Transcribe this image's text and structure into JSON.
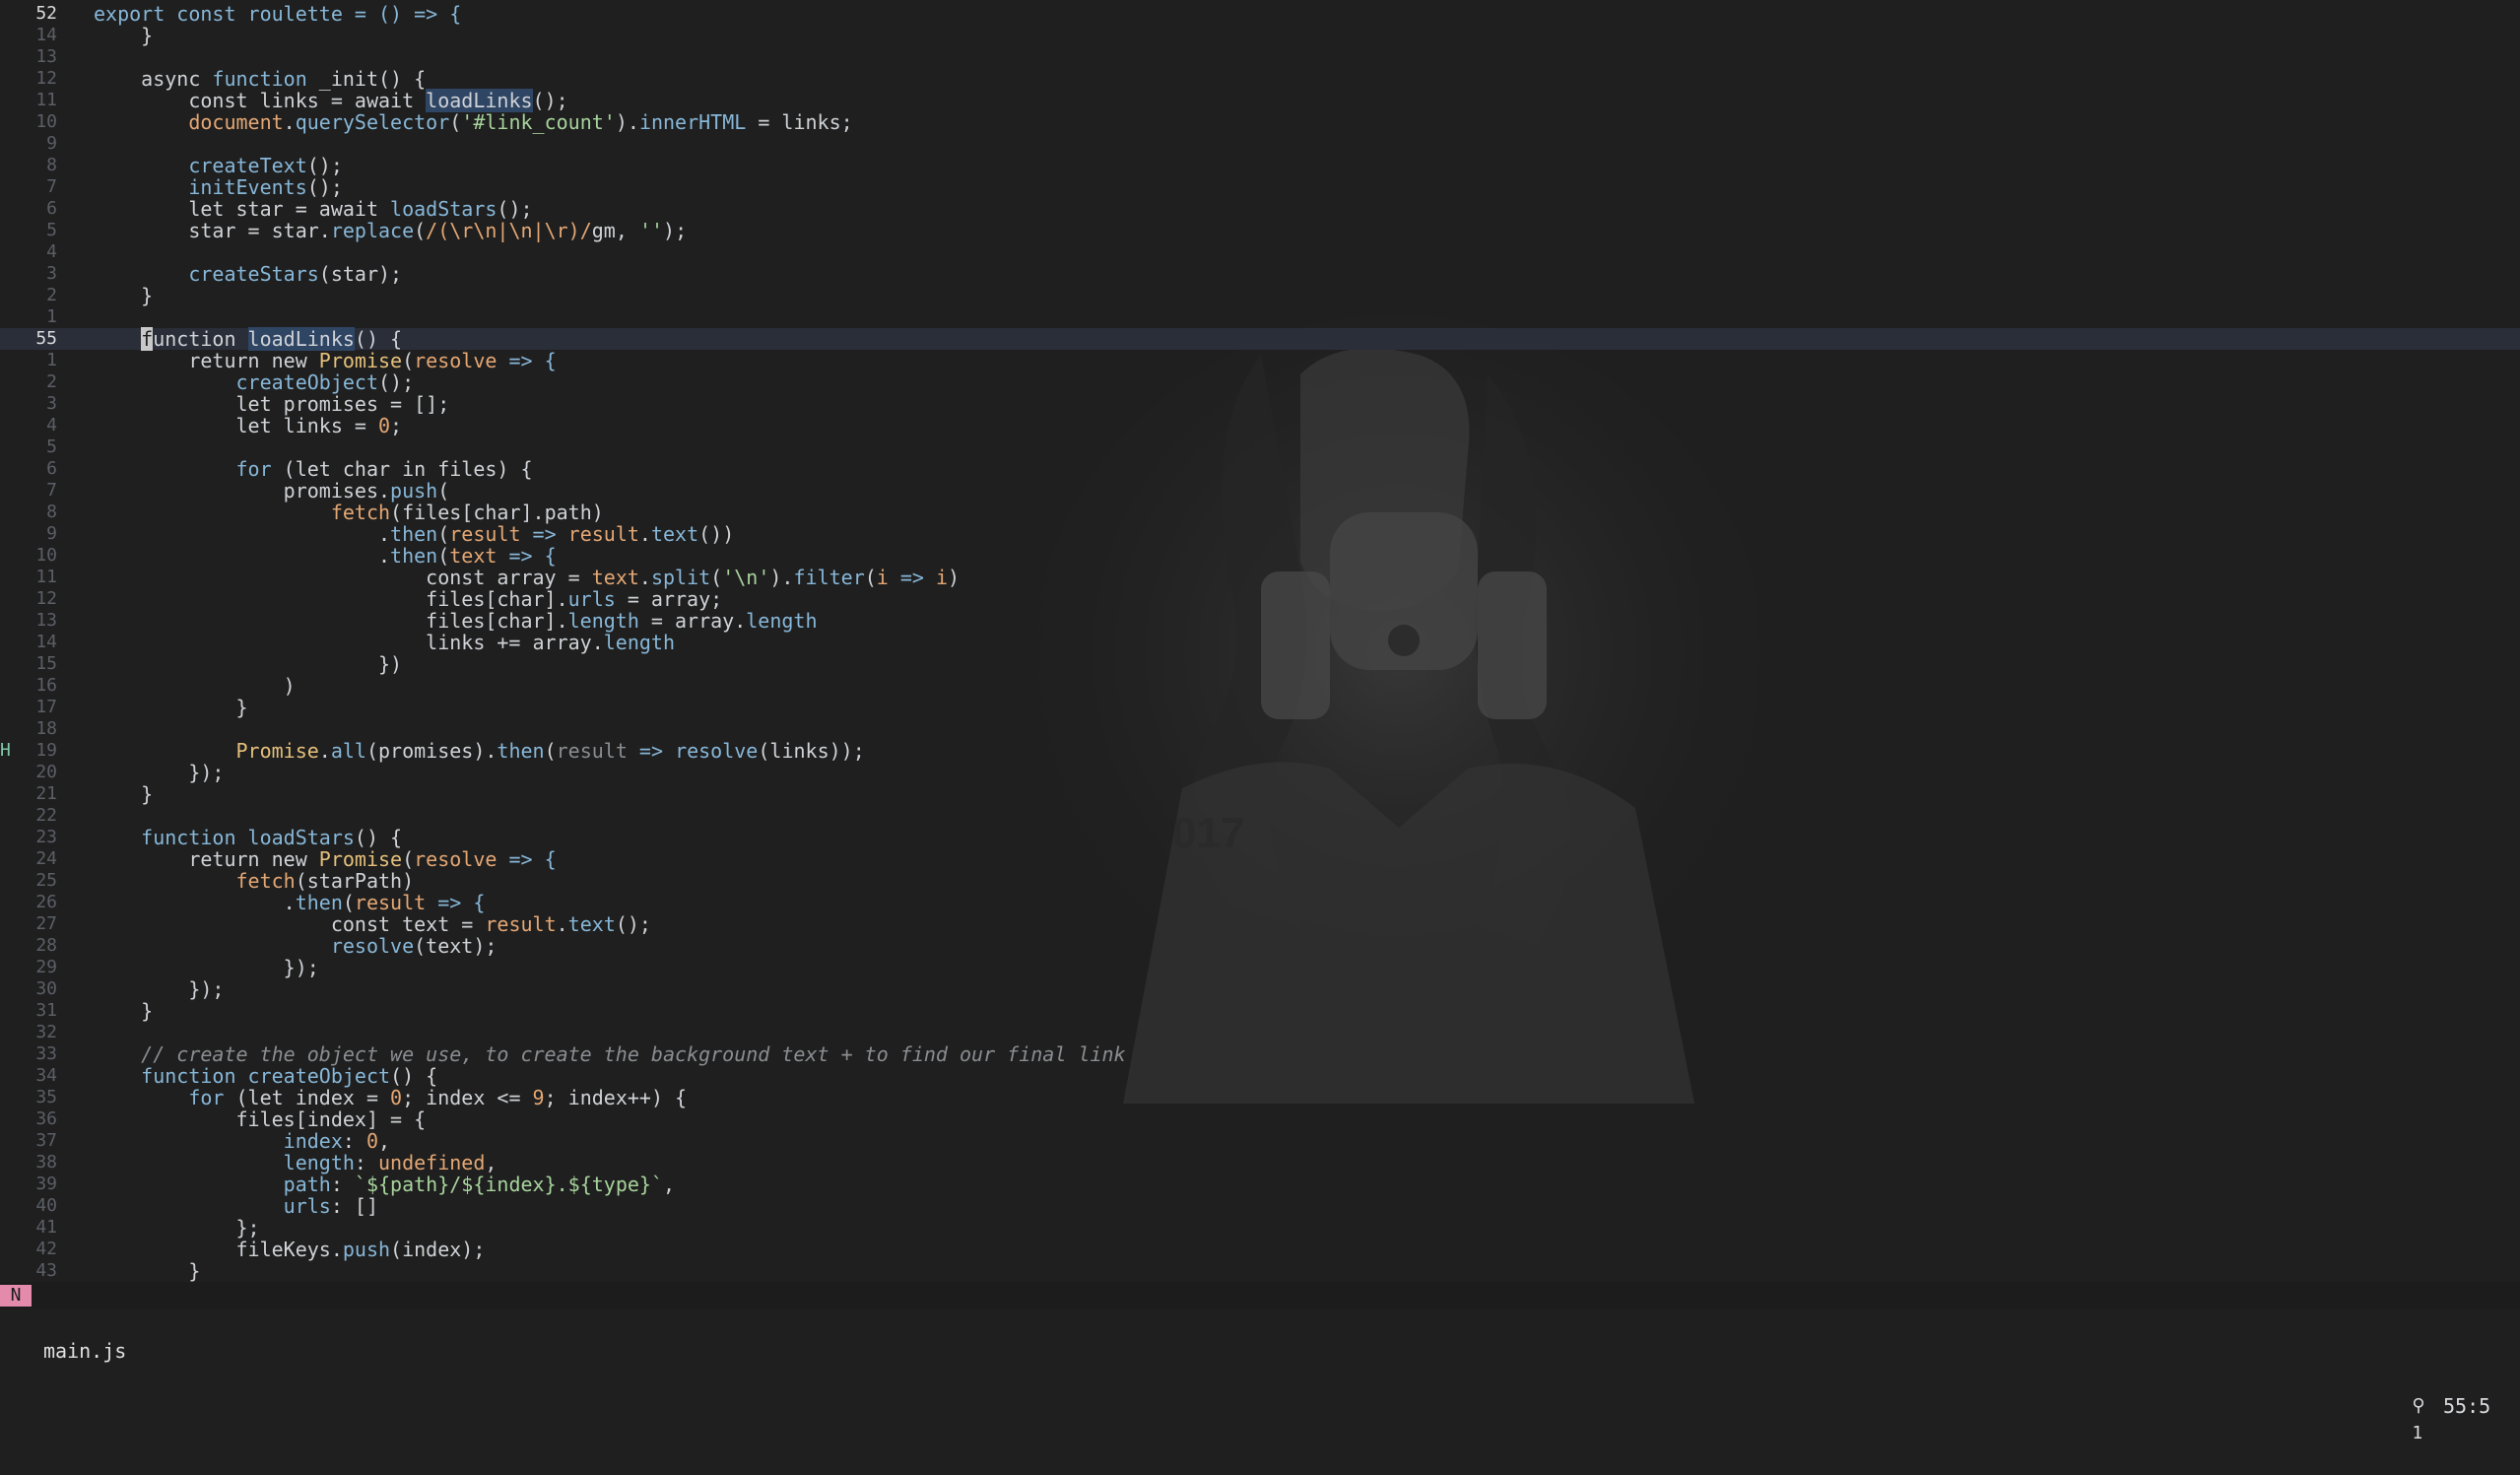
{
  "editor": {
    "lines": [
      {
        "sign": "",
        "num": "52",
        "current_num": true,
        "current": false,
        "tokens": [
          [
            "export const roulette = () => {",
            "#87b7d8"
          ]
        ]
      },
      {
        "sign": "",
        "num": "14",
        "tokens": [
          [
            "    }",
            "#cfd2d6"
          ]
        ]
      },
      {
        "sign": "",
        "num": "13",
        "tokens": [
          [
            "",
            "#cfd2d6"
          ]
        ]
      },
      {
        "sign": "",
        "num": "12",
        "tokens": [
          [
            "    async ",
            "#cfd2d6"
          ],
          [
            "function ",
            "#87b7d8"
          ],
          [
            "_init",
            "#cfd2d6"
          ],
          [
            "() {",
            "#cfd2d6"
          ]
        ]
      },
      {
        "sign": "",
        "num": "11",
        "tokens": [
          [
            "        const links = await ",
            "#cfd2d6"
          ],
          [
            "loadLinks",
            "#cfd2d6",
            "ref"
          ],
          [
            "();",
            "#cfd2d6"
          ]
        ]
      },
      {
        "sign": "",
        "num": "10",
        "tokens": [
          [
            "        document",
            "#e4a774"
          ],
          [
            ".",
            "#cfd2d6"
          ],
          [
            "querySelector",
            "#87b7d8"
          ],
          [
            "(",
            "#cfd2d6"
          ],
          [
            "'#link_count'",
            "#a7d39c"
          ],
          [
            ").",
            "#cfd2d6"
          ],
          [
            "innerHTML",
            "#87b7d8"
          ],
          [
            " = links;",
            "#cfd2d6"
          ]
        ]
      },
      {
        "sign": "",
        "num": "9",
        "tokens": [
          [
            "",
            "#cfd2d6"
          ]
        ]
      },
      {
        "sign": "",
        "num": "8",
        "tokens": [
          [
            "        createText",
            "#87b7d8"
          ],
          [
            "();",
            "#cfd2d6"
          ]
        ]
      },
      {
        "sign": "",
        "num": "7",
        "tokens": [
          [
            "        initEvents",
            "#87b7d8"
          ],
          [
            "();",
            "#cfd2d6"
          ]
        ]
      },
      {
        "sign": "",
        "num": "6",
        "tokens": [
          [
            "        let star = await ",
            "#cfd2d6"
          ],
          [
            "loadStars",
            "#87b7d8"
          ],
          [
            "();",
            "#cfd2d6"
          ]
        ]
      },
      {
        "sign": "",
        "num": "5",
        "tokens": [
          [
            "        star = star.",
            "#cfd2d6"
          ],
          [
            "replace",
            "#87b7d8"
          ],
          [
            "(",
            "#cfd2d6"
          ],
          [
            "/(\\r\\n|\\n|\\r)/",
            "#e4a774"
          ],
          [
            "gm",
            "#cfd2d6"
          ],
          [
            ", ",
            "#cfd2d6"
          ],
          [
            "''",
            "#a7d39c"
          ],
          [
            ");",
            "#cfd2d6"
          ]
        ]
      },
      {
        "sign": "",
        "num": "4",
        "tokens": [
          [
            "",
            "#cfd2d6"
          ]
        ]
      },
      {
        "sign": "",
        "num": "3",
        "tokens": [
          [
            "        createStars",
            "#87b7d8"
          ],
          [
            "(star);",
            "#cfd2d6"
          ]
        ]
      },
      {
        "sign": "",
        "num": "2",
        "tokens": [
          [
            "    }",
            "#cfd2d6"
          ]
        ]
      },
      {
        "sign": "",
        "num": "1",
        "tokens": [
          [
            "",
            "#cfd2d6"
          ]
        ]
      },
      {
        "sign": "",
        "num": "55",
        "current_num": true,
        "current": true,
        "tokens": [
          [
            "    ",
            "#cfd2d6"
          ],
          [
            "f",
            "#1f1f1f",
            "cursor"
          ],
          [
            "unction ",
            "#cfd2d6"
          ],
          [
            "loadLinks",
            "#cfd2d6",
            "ref"
          ],
          [
            "() {",
            "#cfd2d6"
          ]
        ]
      },
      {
        "sign": "",
        "num": "1",
        "tokens": [
          [
            "        return new ",
            "#cfd2d6"
          ],
          [
            "Promise",
            "#e5c07b"
          ],
          [
            "(",
            "#cfd2d6"
          ],
          [
            "resolve",
            "#e4a774"
          ],
          [
            " => {",
            "#87b7d8"
          ]
        ]
      },
      {
        "sign": "",
        "num": "2",
        "tokens": [
          [
            "            createObject",
            "#87b7d8"
          ],
          [
            "();",
            "#cfd2d6"
          ]
        ]
      },
      {
        "sign": "",
        "num": "3",
        "tokens": [
          [
            "            let promises = [];",
            "#cfd2d6"
          ]
        ]
      },
      {
        "sign": "",
        "num": "4",
        "tokens": [
          [
            "            let links = ",
            "#cfd2d6"
          ],
          [
            "0",
            "#e4a774"
          ],
          [
            ";",
            "#cfd2d6"
          ]
        ]
      },
      {
        "sign": "",
        "num": "5",
        "tokens": [
          [
            "",
            "#cfd2d6"
          ]
        ]
      },
      {
        "sign": "",
        "num": "6",
        "tokens": [
          [
            "            ",
            "#cfd2d6"
          ],
          [
            "for",
            "#87b7d8"
          ],
          [
            " (let char in files) {",
            "#cfd2d6"
          ]
        ]
      },
      {
        "sign": "",
        "num": "7",
        "tokens": [
          [
            "                promises.",
            "#cfd2d6"
          ],
          [
            "push",
            "#87b7d8"
          ],
          [
            "(",
            "#cfd2d6"
          ]
        ]
      },
      {
        "sign": "",
        "num": "8",
        "tokens": [
          [
            "                    ",
            "#cfd2d6"
          ],
          [
            "fetch",
            "#e4a774"
          ],
          [
            "(files[char].path)",
            "#cfd2d6"
          ]
        ]
      },
      {
        "sign": "",
        "num": "9",
        "tokens": [
          [
            "                        .",
            "#cfd2d6"
          ],
          [
            "then",
            "#87b7d8"
          ],
          [
            "(",
            "#cfd2d6"
          ],
          [
            "result",
            "#e4a774"
          ],
          [
            " => ",
            "#87b7d8"
          ],
          [
            "result",
            "#e4a774"
          ],
          [
            ".",
            "#cfd2d6"
          ],
          [
            "text",
            "#87b7d8"
          ],
          [
            "())",
            "#cfd2d6"
          ]
        ]
      },
      {
        "sign": "",
        "num": "10",
        "tokens": [
          [
            "                        .",
            "#cfd2d6"
          ],
          [
            "then",
            "#87b7d8"
          ],
          [
            "(",
            "#cfd2d6"
          ],
          [
            "text",
            "#e4a774"
          ],
          [
            " => {",
            "#87b7d8"
          ]
        ]
      },
      {
        "sign": "",
        "num": "11",
        "tokens": [
          [
            "                            const array = ",
            "#cfd2d6"
          ],
          [
            "text",
            "#e4a774"
          ],
          [
            ".",
            "#cfd2d6"
          ],
          [
            "split",
            "#87b7d8"
          ],
          [
            "(",
            "#cfd2d6"
          ],
          [
            "'\\n'",
            "#a7d39c"
          ],
          [
            ").",
            "#cfd2d6"
          ],
          [
            "filter",
            "#87b7d8"
          ],
          [
            "(",
            "#cfd2d6"
          ],
          [
            "i",
            "#e4a774"
          ],
          [
            " => ",
            "#87b7d8"
          ],
          [
            "i",
            "#e4a774"
          ],
          [
            ")",
            "#cfd2d6"
          ]
        ]
      },
      {
        "sign": "",
        "num": "12",
        "tokens": [
          [
            "                            files[char].",
            "#cfd2d6"
          ],
          [
            "urls",
            "#87b7d8"
          ],
          [
            " = array;",
            "#cfd2d6"
          ]
        ]
      },
      {
        "sign": "",
        "num": "13",
        "tokens": [
          [
            "                            files[char].",
            "#cfd2d6"
          ],
          [
            "length",
            "#87b7d8"
          ],
          [
            " = array.",
            "#cfd2d6"
          ],
          [
            "length",
            "#87b7d8"
          ]
        ]
      },
      {
        "sign": "",
        "num": "14",
        "tokens": [
          [
            "                            links += array.",
            "#cfd2d6"
          ],
          [
            "length",
            "#87b7d8"
          ]
        ]
      },
      {
        "sign": "",
        "num": "15",
        "tokens": [
          [
            "                        })",
            "#cfd2d6"
          ]
        ]
      },
      {
        "sign": "",
        "num": "16",
        "tokens": [
          [
            "                )",
            "#cfd2d6"
          ]
        ]
      },
      {
        "sign": "",
        "num": "17",
        "tokens": [
          [
            "            }",
            "#cfd2d6"
          ]
        ]
      },
      {
        "sign": "",
        "num": "18",
        "tokens": [
          [
            "",
            "#cfd2d6"
          ]
        ]
      },
      {
        "sign": "H",
        "num": "19",
        "tokens": [
          [
            "            ",
            "#cfd2d6"
          ],
          [
            "Promise",
            "#e5c07b"
          ],
          [
            ".",
            "#cfd2d6"
          ],
          [
            "all",
            "#87b7d8"
          ],
          [
            "(promises).",
            "#cfd2d6"
          ],
          [
            "then",
            "#87b7d8"
          ],
          [
            "(",
            "#cfd2d6"
          ],
          [
            "result",
            "#8a8d91"
          ],
          [
            " => ",
            "#87b7d8"
          ],
          [
            "resolve",
            "#87b7d8"
          ],
          [
            "(links));",
            "#cfd2d6"
          ]
        ]
      },
      {
        "sign": "",
        "num": "20",
        "tokens": [
          [
            "        });",
            "#cfd2d6"
          ]
        ]
      },
      {
        "sign": "",
        "num": "21",
        "tokens": [
          [
            "    }",
            "#cfd2d6"
          ]
        ]
      },
      {
        "sign": "",
        "num": "22",
        "tokens": [
          [
            "",
            "#cfd2d6"
          ]
        ]
      },
      {
        "sign": "",
        "num": "23",
        "tokens": [
          [
            "    ",
            "#cfd2d6"
          ],
          [
            "function ",
            "#87b7d8"
          ],
          [
            "loadStars",
            "#87b7d8"
          ],
          [
            "() {",
            "#cfd2d6"
          ]
        ]
      },
      {
        "sign": "",
        "num": "24",
        "tokens": [
          [
            "        return new ",
            "#cfd2d6"
          ],
          [
            "Promise",
            "#e5c07b"
          ],
          [
            "(",
            "#cfd2d6"
          ],
          [
            "resolve",
            "#e4a774"
          ],
          [
            " => {",
            "#87b7d8"
          ]
        ]
      },
      {
        "sign": "",
        "num": "25",
        "tokens": [
          [
            "            ",
            "#cfd2d6"
          ],
          [
            "fetch",
            "#e4a774"
          ],
          [
            "(starPath)",
            "#cfd2d6"
          ]
        ]
      },
      {
        "sign": "",
        "num": "26",
        "tokens": [
          [
            "                .",
            "#cfd2d6"
          ],
          [
            "then",
            "#87b7d8"
          ],
          [
            "(",
            "#cfd2d6"
          ],
          [
            "result",
            "#e4a774"
          ],
          [
            " => {",
            "#87b7d8"
          ]
        ]
      },
      {
        "sign": "",
        "num": "27",
        "tokens": [
          [
            "                    const text = ",
            "#cfd2d6"
          ],
          [
            "result",
            "#e4a774"
          ],
          [
            ".",
            "#cfd2d6"
          ],
          [
            "text",
            "#87b7d8"
          ],
          [
            "();",
            "#cfd2d6"
          ]
        ]
      },
      {
        "sign": "",
        "num": "28",
        "tokens": [
          [
            "                    ",
            "#cfd2d6"
          ],
          [
            "resolve",
            "#87b7d8"
          ],
          [
            "(text);",
            "#cfd2d6"
          ]
        ]
      },
      {
        "sign": "",
        "num": "29",
        "tokens": [
          [
            "                });",
            "#cfd2d6"
          ]
        ]
      },
      {
        "sign": "",
        "num": "30",
        "tokens": [
          [
            "        });",
            "#cfd2d6"
          ]
        ]
      },
      {
        "sign": "",
        "num": "31",
        "tokens": [
          [
            "    }",
            "#cfd2d6"
          ]
        ]
      },
      {
        "sign": "",
        "num": "32",
        "tokens": [
          [
            "",
            "#cfd2d6"
          ]
        ]
      },
      {
        "sign": "",
        "num": "33",
        "tokens": [
          [
            "    // create the object we use, to create the background text + to find our final link",
            "#8a8d91",
            "italic"
          ]
        ]
      },
      {
        "sign": "",
        "num": "34",
        "tokens": [
          [
            "    ",
            "#cfd2d6"
          ],
          [
            "function ",
            "#87b7d8"
          ],
          [
            "createObject",
            "#87b7d8"
          ],
          [
            "() {",
            "#cfd2d6"
          ]
        ]
      },
      {
        "sign": "",
        "num": "35",
        "tokens": [
          [
            "        ",
            "#cfd2d6"
          ],
          [
            "for",
            "#87b7d8"
          ],
          [
            " (let index = ",
            "#cfd2d6"
          ],
          [
            "0",
            "#e4a774"
          ],
          [
            "; index <= ",
            "#cfd2d6"
          ],
          [
            "9",
            "#e4a774"
          ],
          [
            "; index++) {",
            "#cfd2d6"
          ]
        ]
      },
      {
        "sign": "",
        "num": "36",
        "tokens": [
          [
            "            files[index] = {",
            "#cfd2d6"
          ]
        ]
      },
      {
        "sign": "",
        "num": "37",
        "tokens": [
          [
            "                ",
            "#cfd2d6"
          ],
          [
            "index",
            "#87b7d8"
          ],
          [
            ": ",
            "#cfd2d6"
          ],
          [
            "0",
            "#e4a774"
          ],
          [
            ",",
            "#cfd2d6"
          ]
        ]
      },
      {
        "sign": "",
        "num": "38",
        "tokens": [
          [
            "                ",
            "#cfd2d6"
          ],
          [
            "length",
            "#87b7d8"
          ],
          [
            ": ",
            "#cfd2d6"
          ],
          [
            "undefined",
            "#e4a774"
          ],
          [
            ",",
            "#cfd2d6"
          ]
        ]
      },
      {
        "sign": "",
        "num": "39",
        "tokens": [
          [
            "                ",
            "#cfd2d6"
          ],
          [
            "path",
            "#87b7d8"
          ],
          [
            ": ",
            "#cfd2d6"
          ],
          [
            "`${path}/${index}.${type}`",
            "#a7d39c"
          ],
          [
            ",",
            "#cfd2d6"
          ]
        ]
      },
      {
        "sign": "",
        "num": "40",
        "tokens": [
          [
            "                ",
            "#cfd2d6"
          ],
          [
            "urls",
            "#87b7d8"
          ],
          [
            ": []",
            "#cfd2d6"
          ]
        ]
      },
      {
        "sign": "",
        "num": "41",
        "tokens": [
          [
            "            };",
            "#cfd2d6"
          ]
        ]
      },
      {
        "sign": "",
        "num": "42",
        "tokens": [
          [
            "            fileKeys.",
            "#cfd2d6"
          ],
          [
            "push",
            "#87b7d8"
          ],
          [
            "(index);",
            "#cfd2d6"
          ]
        ]
      },
      {
        "sign": "",
        "num": "43",
        "tokens": [
          [
            "        }",
            "#cfd2d6"
          ]
        ]
      }
    ]
  },
  "statusbar": {
    "mode": "N",
    "filename": "main.js",
    "diagnostics": "Ὂ1 1",
    "diagnostics_icon": "lightbulb-icon",
    "diagnostics_count": "1",
    "position": "55:5"
  },
  "colors": {
    "background": "#1f1f1f",
    "current_line": "#2a2e38",
    "mode_badge": "#e48bab",
    "keyword": "#87b7d8",
    "string": "#a7d39c",
    "number": "#e4a774",
    "comment": "#8a8d91",
    "type": "#e5c07b"
  }
}
